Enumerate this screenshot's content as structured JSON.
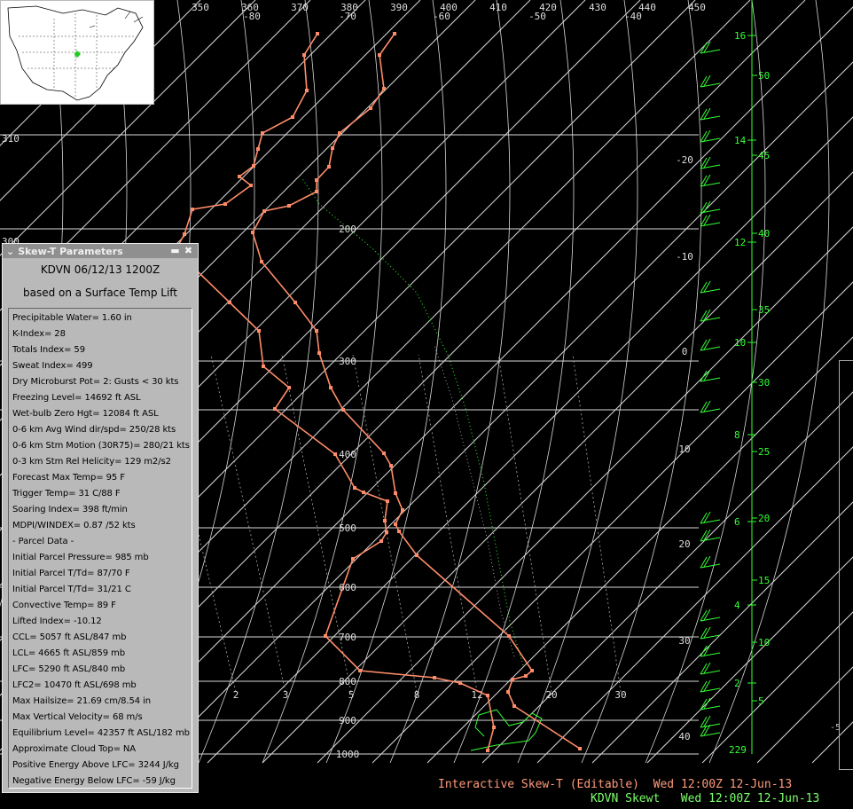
{
  "window": {
    "title": "Interactive Skew-T (Editable)",
    "subtitle": "KDVN Skewt",
    "datetime": "Wed 12:00Z 12-Jun-13"
  },
  "colors": {
    "background": "#000000",
    "grid": "#ffffff",
    "sounding": "#ff8c69",
    "wind_barbs": "#33ff33",
    "height_axis": "#33ff33",
    "panel": "#b9b9b9"
  },
  "skewt": {
    "theta_labels": [
      "350",
      "360",
      "370",
      "380",
      "390",
      "400",
      "410",
      "420",
      "430",
      "440",
      "450"
    ],
    "temp_labels_top": [
      "-80",
      "-70",
      "-60",
      "-50",
      "-40"
    ],
    "temp_labels_side": [
      "-20",
      "-10",
      "0",
      "10",
      "20",
      "30",
      "40"
    ],
    "pressure_labels": [
      "200",
      "300",
      "400",
      "500",
      "600",
      "700",
      "800",
      "900",
      "1000"
    ],
    "mixing_ratio_labels": [
      "2",
      "3",
      "5",
      "8",
      "12",
      "20",
      "30"
    ],
    "edge_labels": [
      "310",
      "300"
    ],
    "height_km_labels": [
      "16",
      "14",
      "12",
      "10",
      "8",
      "6",
      "4",
      "2"
    ],
    "height_kft_labels": [
      "50",
      "45",
      "40",
      "35",
      "30",
      "25",
      "20",
      "15",
      "10",
      "5"
    ],
    "surface_height": "229",
    "side_value": "-5"
  },
  "parameters_panel": {
    "title": "Skew-T Parameters",
    "station_line": "KDVN 06/12/13 1200Z",
    "basis_line": "based on a Surface Temp Lift",
    "items": [
      "Precipitable Water= 1.60 in",
      "K-Index= 28",
      "Totals Index= 59",
      "Sweat Index= 499",
      "Dry Microburst Pot= 2: Gusts < 30 kts",
      "Freezing Level= 14692 ft ASL",
      "Wet-bulb Zero Hgt= 12084 ft ASL",
      "0-6 km Avg Wind dir/spd= 250/28 kts",
      "0-6 km Stm Motion (30R75)= 280/21 kts",
      "0-3 km Stm Rel Helicity= 129 m2/s2",
      "Forecast Max Temp= 95 F",
      "Trigger Temp= 31 C/88 F",
      "Soaring Index= 398 ft/min",
      "MDPI/WINDEX= 0.87 /52 kts",
      " - Parcel Data -",
      "Initial Parcel Pressure= 985 mb",
      "Initial Parcel T/Td= 87/70 F",
      "Initial Parcel T/Td= 31/21 C",
      "Convective Temp= 89 F",
      "Lifted Index= -10.12",
      "CCL= 5057 ft ASL/847 mb",
      "LCL= 4665 ft ASL/859 mb",
      "LFC= 5290 ft ASL/840 mb",
      "LFC2= 10470 ft ASL/698 mb",
      "Max Hailsize= 21.69 cm/8.54 in",
      "Max Vertical Velocity= 68 m/s",
      "Equilibrium Level= 42357 ft ASL/182 mb",
      "Approximate Cloud Top= NA",
      "Positive Energy Above LFC= 3244 J/kg",
      "Negative Energy Below LFC= -59 J/kg"
    ]
  }
}
